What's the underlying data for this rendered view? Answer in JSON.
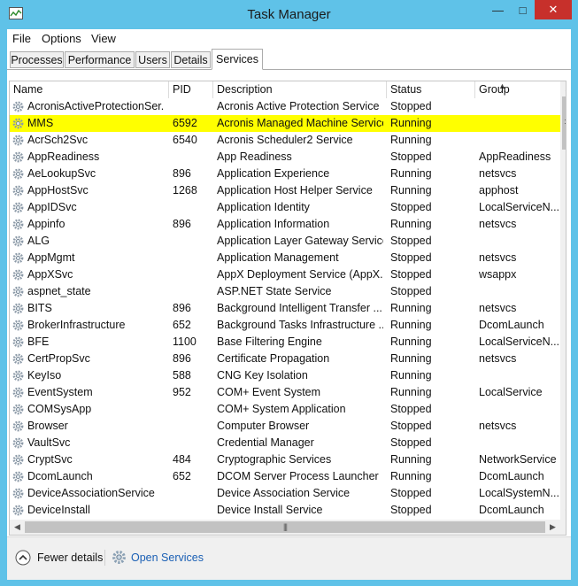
{
  "window": {
    "title": "Task Manager",
    "minimize_glyph": "—",
    "maximize_glyph": "□",
    "close_glyph": "✕"
  },
  "menu": [
    "File",
    "Options",
    "View"
  ],
  "tabs": [
    "Processes",
    "Performance",
    "Users",
    "Details",
    "Services"
  ],
  "active_tab": "Services",
  "columns": {
    "name": "Name",
    "pid": "PID",
    "description": "Description",
    "status": "Status",
    "group": "Group"
  },
  "sort": {
    "column": "Description",
    "glyph": "▲"
  },
  "services": [
    {
      "name": "AcronisActiveProtectionSer...",
      "pid": "",
      "description": "Acronis Active Protection Service",
      "status": "Stopped",
      "group": ""
    },
    {
      "name": "MMS",
      "pid": "6592",
      "description": "Acronis Managed Machine Service",
      "status": "Running",
      "group": "",
      "highlighted": true
    },
    {
      "name": "AcrSch2Svc",
      "pid": "6540",
      "description": "Acronis Scheduler2 Service",
      "status": "Running",
      "group": ""
    },
    {
      "name": "AppReadiness",
      "pid": "",
      "description": "App Readiness",
      "status": "Stopped",
      "group": "AppReadiness"
    },
    {
      "name": "AeLookupSvc",
      "pid": "896",
      "description": "Application Experience",
      "status": "Running",
      "group": "netsvcs"
    },
    {
      "name": "AppHostSvc",
      "pid": "1268",
      "description": "Application Host Helper Service",
      "status": "Running",
      "group": "apphost"
    },
    {
      "name": "AppIDSvc",
      "pid": "",
      "description": "Application Identity",
      "status": "Stopped",
      "group": "LocalServiceN..."
    },
    {
      "name": "Appinfo",
      "pid": "896",
      "description": "Application Information",
      "status": "Running",
      "group": "netsvcs"
    },
    {
      "name": "ALG",
      "pid": "",
      "description": "Application Layer Gateway Service",
      "status": "Stopped",
      "group": ""
    },
    {
      "name": "AppMgmt",
      "pid": "",
      "description": "Application Management",
      "status": "Stopped",
      "group": "netsvcs"
    },
    {
      "name": "AppXSvc",
      "pid": "",
      "description": "AppX Deployment Service (AppX...",
      "status": "Stopped",
      "group": "wsappx"
    },
    {
      "name": "aspnet_state",
      "pid": "",
      "description": "ASP.NET State Service",
      "status": "Stopped",
      "group": ""
    },
    {
      "name": "BITS",
      "pid": "896",
      "description": "Background Intelligent Transfer ...",
      "status": "Running",
      "group": "netsvcs"
    },
    {
      "name": "BrokerInfrastructure",
      "pid": "652",
      "description": "Background Tasks Infrastructure ...",
      "status": "Running",
      "group": "DcomLaunch"
    },
    {
      "name": "BFE",
      "pid": "1100",
      "description": "Base Filtering Engine",
      "status": "Running",
      "group": "LocalServiceN..."
    },
    {
      "name": "CertPropSvc",
      "pid": "896",
      "description": "Certificate Propagation",
      "status": "Running",
      "group": "netsvcs"
    },
    {
      "name": "KeyIso",
      "pid": "588",
      "description": "CNG Key Isolation",
      "status": "Running",
      "group": ""
    },
    {
      "name": "EventSystem",
      "pid": "952",
      "description": "COM+ Event System",
      "status": "Running",
      "group": "LocalService"
    },
    {
      "name": "COMSysApp",
      "pid": "",
      "description": "COM+ System Application",
      "status": "Stopped",
      "group": ""
    },
    {
      "name": "Browser",
      "pid": "",
      "description": "Computer Browser",
      "status": "Stopped",
      "group": "netsvcs"
    },
    {
      "name": "VaultSvc",
      "pid": "",
      "description": "Credential Manager",
      "status": "Stopped",
      "group": ""
    },
    {
      "name": "CryptSvc",
      "pid": "484",
      "description": "Cryptographic Services",
      "status": "Running",
      "group": "NetworkService"
    },
    {
      "name": "DcomLaunch",
      "pid": "652",
      "description": "DCOM Server Process Launcher",
      "status": "Running",
      "group": "DcomLaunch"
    },
    {
      "name": "DeviceAssociationService",
      "pid": "",
      "description": "Device Association Service",
      "status": "Stopped",
      "group": "LocalSystemN..."
    },
    {
      "name": "DeviceInstall",
      "pid": "",
      "description": "Device Install Service",
      "status": "Stopped",
      "group": "DcomLaunch"
    }
  ],
  "scroll": {
    "up": "▲",
    "down": "▼",
    "left": "◀",
    "right": "▶",
    "grip": "|||"
  },
  "footer": {
    "fewer_details": "Fewer details",
    "open_services": "Open Services"
  },
  "colors": {
    "highlight": "#ffff00",
    "titlebar": "#5fc2e8",
    "close": "#c7302b",
    "link": "#1a5fb4"
  }
}
